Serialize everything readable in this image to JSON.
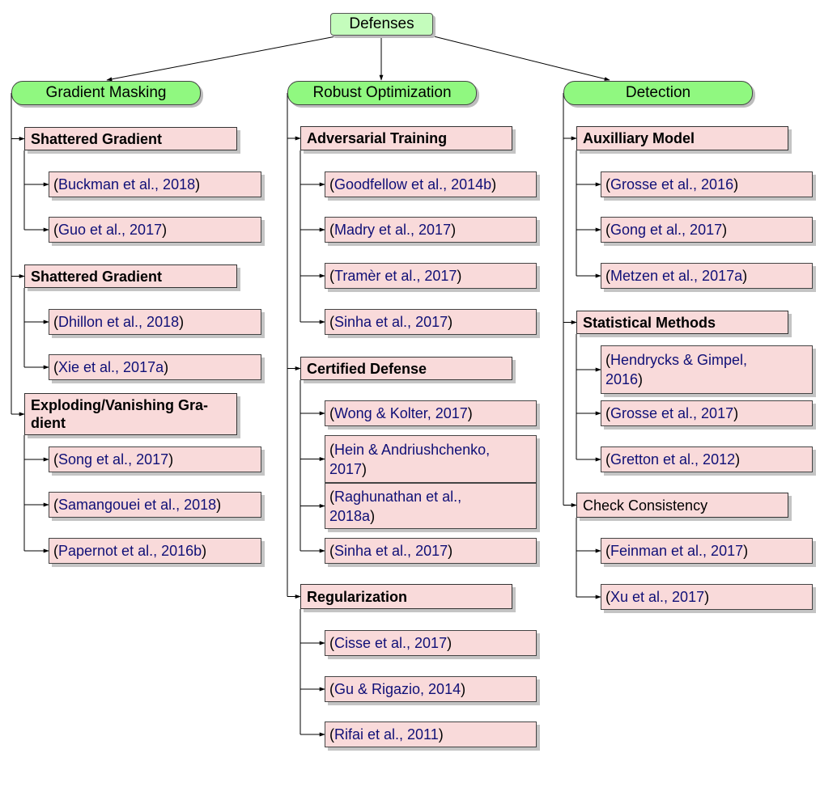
{
  "root": {
    "label": "Defenses"
  },
  "categories": [
    {
      "label": "Gradient Masking",
      "groups": [
        {
          "label": "Shattered Gradient",
          "bold": true,
          "citations": [
            "Buckman et al., 2018",
            "Guo et al., 2017"
          ]
        },
        {
          "label": "Shattered Gradient",
          "bold": true,
          "citations": [
            "Dhillon et al., 2018",
            "Xie et al., 2017a"
          ]
        },
        {
          "label": "Exploding/Vanishing Gra-\ndient",
          "bold": true,
          "citations": [
            "Song et al., 2017",
            "Samangouei et al., 2018",
            "Papernot et al., 2016b"
          ]
        }
      ]
    },
    {
      "label": "Robust Optimization",
      "groups": [
        {
          "label": "Adversarial Training",
          "bold": true,
          "citations": [
            "Goodfellow et al., 2014b",
            "Madry et al., 2017",
            "Tramèr et al., 2017",
            "Sinha et al., 2017"
          ]
        },
        {
          "label": "Certified Defense",
          "bold": true,
          "citations": [
            "Wong & Kolter, 2017",
            "Hein & Andriushchenko,\n2017",
            "Raghunathan et al.,\n2018a",
            "Sinha et al., 2017"
          ]
        },
        {
          "label": "Regularization",
          "bold": true,
          "citations": [
            "Cisse et al., 2017",
            "Gu & Rigazio, 2014",
            "Rifai et al., 2011"
          ]
        }
      ]
    },
    {
      "label": "Detection",
      "groups": [
        {
          "label": "Auxilliary Model",
          "bold": true,
          "citations": [
            "Grosse et al., 2016",
            "Gong et al., 2017",
            "Metzen et al., 2017a"
          ]
        },
        {
          "label": "Statistical Methods",
          "bold": true,
          "citations": [
            "Hendrycks & Gimpel,\n2016",
            "Grosse et al., 2017",
            "Gretton et al., 2012"
          ]
        },
        {
          "label": "Check Consistency",
          "bold": false,
          "citations": [
            "Feinman et al., 2017",
            "Xu et al., 2017"
          ]
        }
      ]
    }
  ],
  "colors": {
    "root_fill": "#c4fcbc",
    "category_fill": "#90f880",
    "leaf_fill": "#f9dada",
    "citation_text": "#101077",
    "edge": "#000000"
  }
}
